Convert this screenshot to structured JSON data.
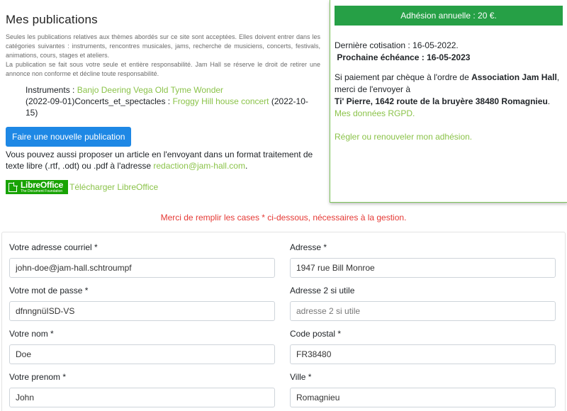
{
  "publications": {
    "title": "Mes publications",
    "note_1": "Seules les publications relatives aux thèmes abordés sur ce site sont acceptées. Elles doivent entrer dans les catégories suivantes : instruments, rencontres musicales, jams, recherche de musiciens, concerts, festivals, animations, cours, stages et ateliers.",
    "note_2": "La publication se fait sous votre seule et entière responsabilité. Jam Hall se réserve le droit de retirer une annonce non conforme et décline toute responsabilité.",
    "item1_category": "Instruments : ",
    "item1_link": "Banjo Deering Vega Old Tyme Wonder",
    "item1_date": "(2022-09-01)",
    "item2_category": "Concerts_et_spectacles : ",
    "item2_link": "Froggy Hill house concert",
    "item2_date": " (2022-10-15)",
    "new_button": "Faire une nouvelle publication",
    "propose_text": "Vous pouvez aussi proposer un article en l'envoyant dans un format traitement de texte libre (.rtf, .odt) ou .pdf à l'adresse ",
    "propose_email": "redaction@jam-hall.com",
    "propose_end": ".",
    "libreoffice_logo_title": "LibreOffice",
    "libreoffice_logo_sub": "The Document Foundation",
    "libreoffice_link": "Télécharger LibreOffice"
  },
  "membership": {
    "header": "Adhésion annuelle : 20 €.",
    "last_payment": "Dernière cotisation : 16-05-2022.",
    "next_due": "Prochaine échéance : 16-05-2023",
    "cheque_text": "Si paiement par chèque à l'ordre de ",
    "cheque_payee": "Association Jam Hall",
    "cheque_text2": ", merci de l'envoyer à",
    "cheque_address": "Ti' Pierre, 1642 route de la bruyère 38480 Romagnieu",
    "cheque_end": ".",
    "rgpd_link": "Mes données RGPD.",
    "renew_link": "Régler ou renouveler mon adhésion."
  },
  "notice": "Merci de remplir les cases * ci-dessous, nécessaires à la gestion.",
  "form": {
    "email": {
      "label": "Votre adresse courriel *",
      "value": "john-doe@jam-hall.schtroumpf"
    },
    "password": {
      "label": "Votre mot de passe *",
      "value": "dfnngnüISD-VS"
    },
    "name": {
      "label": "Votre nom *",
      "value": "Doe"
    },
    "firstname": {
      "label": "Votre prenom *",
      "value": "John"
    },
    "address": {
      "label": "Adresse *",
      "value": "1947 rue Bill Monroe"
    },
    "address2": {
      "label": "Adresse 2 si utile",
      "value": "",
      "placeholder": "adresse 2 si utile"
    },
    "postal": {
      "label": "Code postal *",
      "value": "FR38480"
    },
    "city": {
      "label": "Ville *",
      "value": "Romagnieu"
    }
  },
  "colors": {
    "link": "#8bc34a",
    "primary_button": "#1e88e5",
    "membership_header": "#26a046",
    "notice": "#e53935"
  }
}
